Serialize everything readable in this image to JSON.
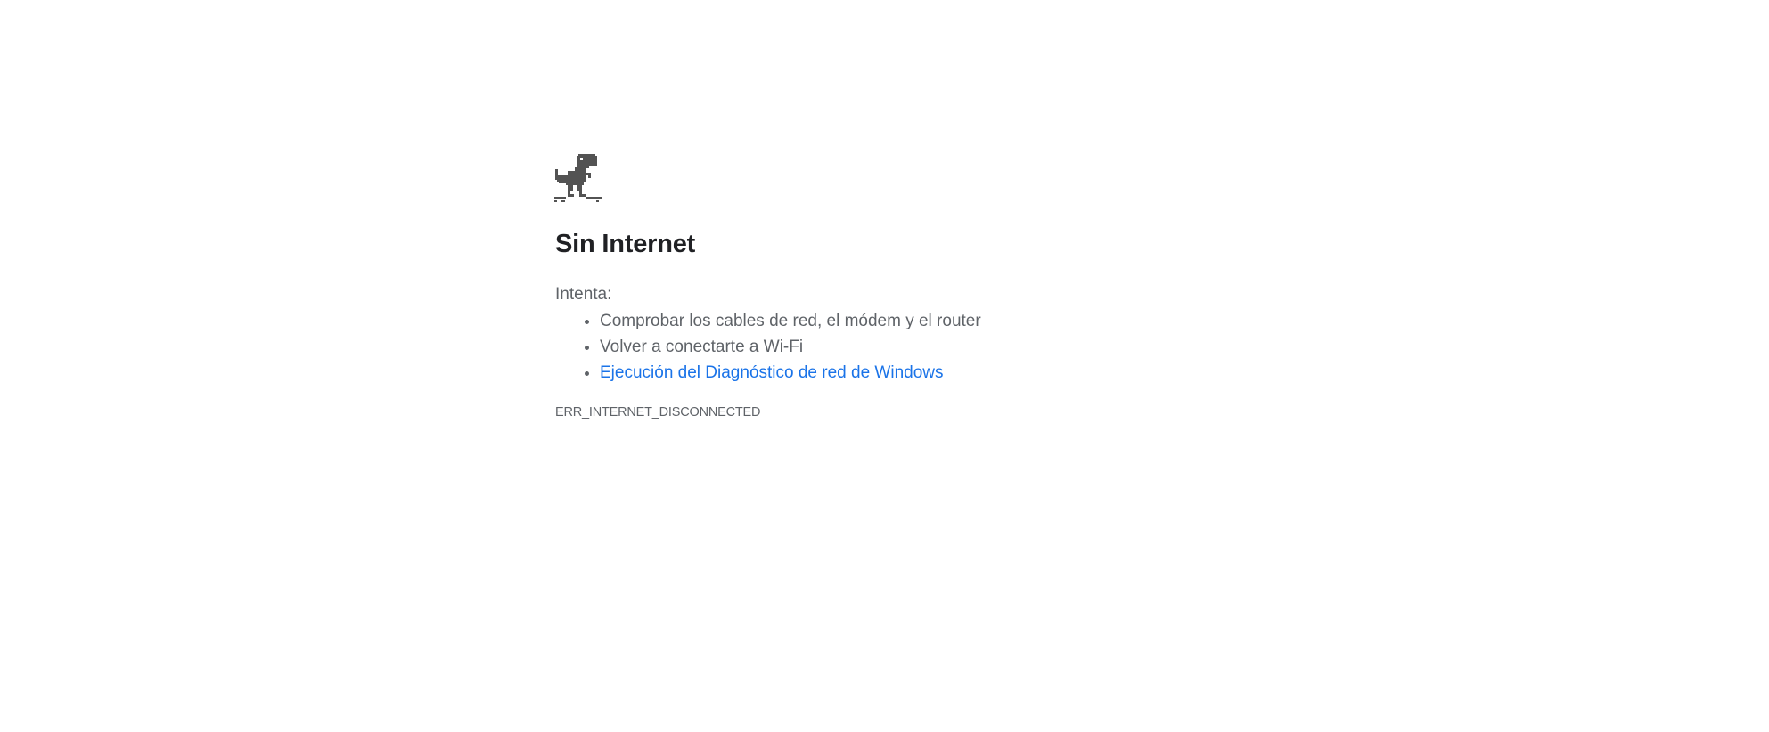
{
  "page": {
    "title": "Sin Internet",
    "intro": "Intenta:",
    "suggestions": [
      "Comprobar los cables de red, el módem y el router",
      "Volver a conectarte a Wi-Fi"
    ],
    "diagnostics_link": "Ejecución del Diagnóstico de red de Windows",
    "error_code": "ERR_INTERNET_DISCONNECTED"
  },
  "icons": {
    "hero": "offline-dinosaur-icon"
  },
  "colors": {
    "heading": "#202124",
    "body_text": "#5f6368",
    "link": "#1a73e8",
    "dino": "#535353",
    "background": "#ffffff"
  }
}
